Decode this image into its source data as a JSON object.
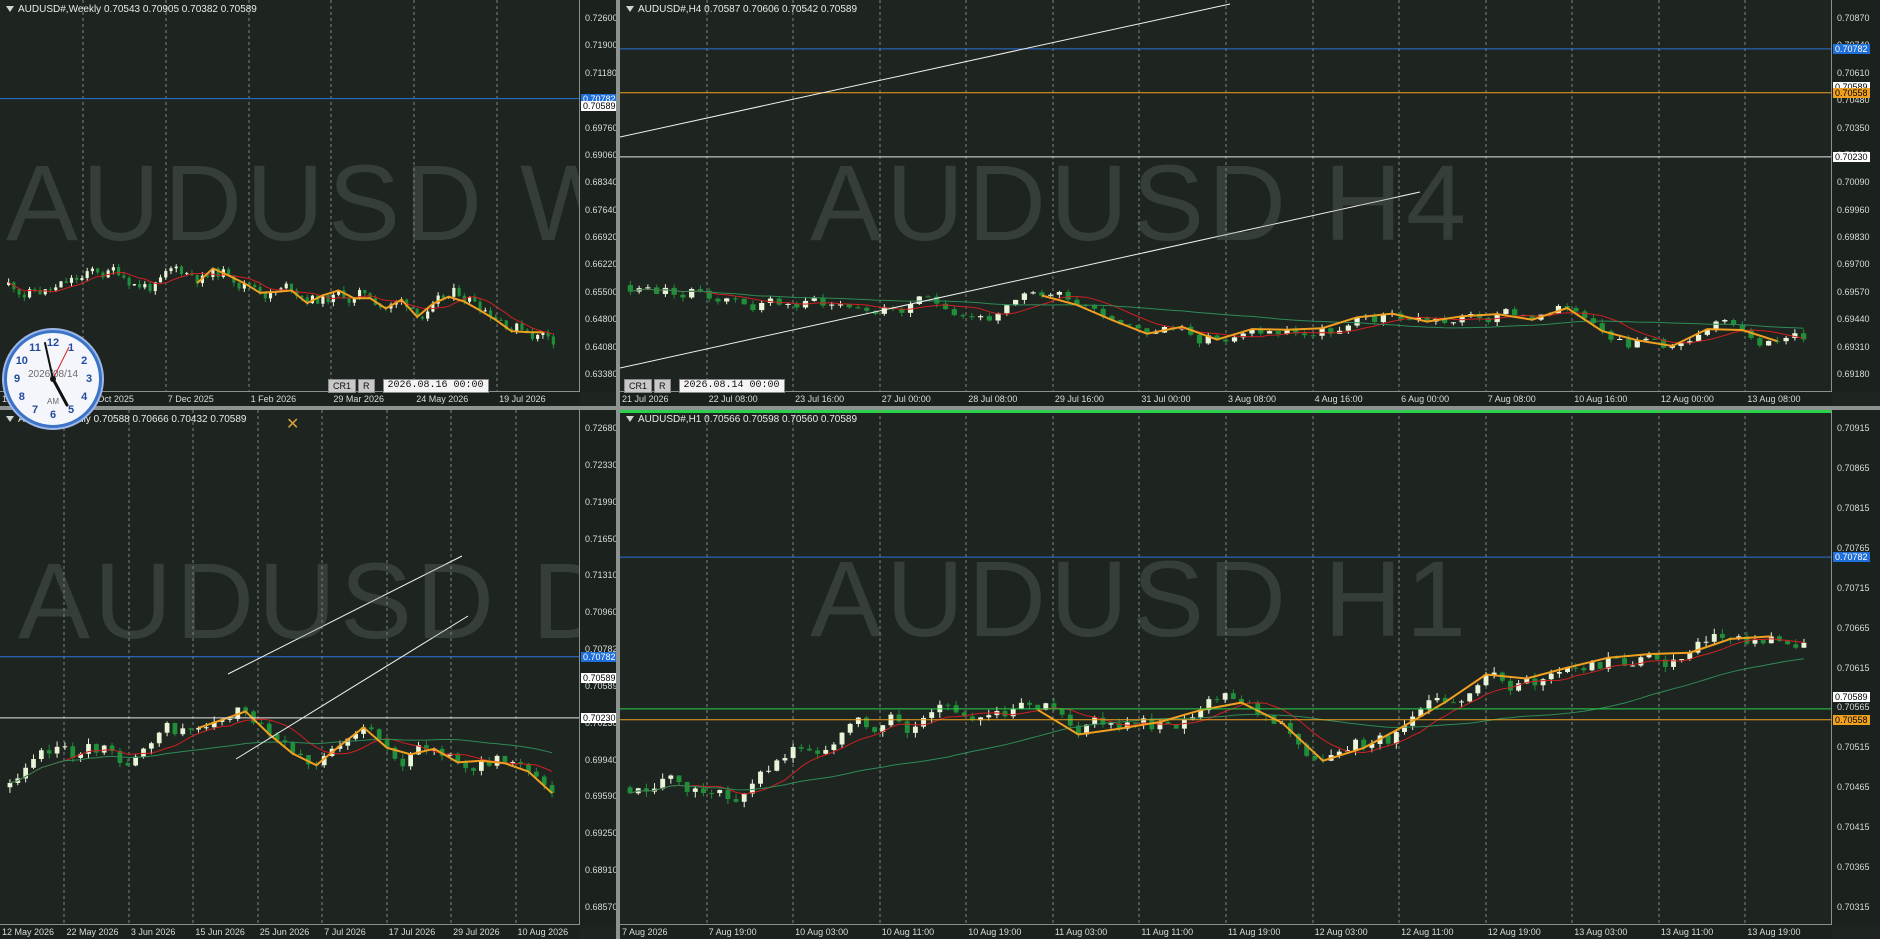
{
  "charts": [
    {
      "id": "w1",
      "header": "AUDUSD#,Weekly  0.70543 0.70905 0.70382 0.70589",
      "watermark": "AUDUSD W1",
      "price_labels": [
        "0.72600",
        "0.71900",
        "0.71180",
        "0.70460",
        "0.69760",
        "0.69060",
        "0.68340",
        "0.67640",
        "0.66920",
        "0.66220",
        "0.65500",
        "0.64800",
        "0.64080",
        "0.63380"
      ],
      "time_labels": [
        "17 Aug 2025",
        "12 Oct 2025",
        "7 Dec 2025",
        "1 Feb 2026",
        "29 Mar 2026",
        "24 May 2026",
        "19 Jul 2026"
      ],
      "tags": [
        {
          "text": "0.70782",
          "bg": "#1e6fd9",
          "fg": "#ffffff",
          "price": 0.70782
        },
        {
          "text": "0.70589",
          "bg": "#ffffff",
          "fg": "#000000",
          "price": 0.70589
        }
      ],
      "status": {
        "b1": "CR1",
        "b2": "R",
        "datetime": "2026.08.16 00:00"
      },
      "ylim": [
        0.6338,
        0.7295
      ],
      "hlines": [
        {
          "price": 0.70782,
          "color": "#2b72d8"
        }
      ],
      "seed": 11,
      "count": 105
    },
    {
      "id": "h4",
      "header": "AUDUSD#,H4  0.70587 0.70606 0.70542 0.70589",
      "watermark": "AUDUSD H4",
      "price_labels": [
        "0.70870",
        "0.70740",
        "0.70610",
        "0.70480",
        "0.70350",
        "0.70230",
        "0.70090",
        "0.69960",
        "0.69830",
        "0.69700",
        "0.69570",
        "0.69440",
        "0.69310",
        "0.69180"
      ],
      "time_labels": [
        "21 Jul 2026",
        "22 Jul 08:00",
        "23 Jul 16:00",
        "27 Jul 00:00",
        "28 Jul 08:00",
        "29 Jul 16:00",
        "31 Jul 00:00",
        "3 Aug 08:00",
        "4 Aug 16:00",
        "6 Aug 00:00",
        "7 Aug 08:00",
        "10 Aug 16:00",
        "12 Aug 00:00",
        "13 Aug 08:00"
      ],
      "tags": [
        {
          "text": "0.70782",
          "bg": "#1e6fd9",
          "fg": "#ffffff",
          "price": 0.70782
        },
        {
          "text": "0.70589",
          "bg": "#ffffff",
          "fg": "#000000",
          "price": 0.70589
        },
        {
          "text": "0.70558",
          "bg": "#f0a020",
          "fg": "#000000",
          "price": 0.70558
        },
        {
          "text": "0.70230",
          "bg": "#ffffff",
          "fg": "#000000",
          "price": 0.7023
        }
      ],
      "status": {
        "b1": "CR1",
        "b2": "R",
        "datetime": "2026.08.14 00:00"
      },
      "ylim": [
        0.6912,
        0.7094
      ],
      "hlines": [
        {
          "price": 0.70782,
          "color": "#2b72d8"
        },
        {
          "price": 0.70558,
          "color": "#f0a020"
        },
        {
          "price": 0.7023,
          "color": "#e8e8e8"
        }
      ],
      "seed": 23,
      "count": 135
    },
    {
      "id": "d1",
      "header": "AUDUSD#,Daily  0.70588 0.70666 0.70432 0.70589",
      "watermark": "AUDUSD D1",
      "price_labels": [
        "0.72680",
        "0.72330",
        "0.71990",
        "0.71650",
        "0.71310",
        "0.70960",
        "0.70782",
        "0.70589",
        "0.70230",
        "0.69940",
        "0.69590",
        "0.69250",
        "0.68910",
        "0.68570"
      ],
      "time_labels": [
        "12 May 2026",
        "22 May 2026",
        "3 Jun 2026",
        "15 Jun 2026",
        "25 Jun 2026",
        "7 Jul 2026",
        "17 Jul 2026",
        "29 Jul 2026",
        "10 Aug 2026"
      ],
      "tags": [
        {
          "text": "0.70782",
          "bg": "#1e6fd9",
          "fg": "#ffffff",
          "price": 0.70782
        },
        {
          "text": "0.70589",
          "bg": "#ffffff",
          "fg": "#000000",
          "price": 0.70589
        },
        {
          "text": "0.70230",
          "bg": "#ffffff",
          "fg": "#000000",
          "price": 0.7023
        }
      ],
      "ylim": [
        0.6852,
        0.7285
      ],
      "hlines": [
        {
          "price": 0.70782,
          "color": "#2b72d8"
        },
        {
          "price": 0.7023,
          "color": "#e8e8e8"
        }
      ],
      "seed": 37,
      "count": 70
    },
    {
      "id": "h1",
      "header": "AUDUSD#,H1  0.70566 0.70598 0.70560 0.70589",
      "watermark": "AUDUSD H1",
      "price_labels": [
        "0.70915",
        "0.70865",
        "0.70815",
        "0.70765",
        "0.70715",
        "0.70665",
        "0.70615",
        "0.70565",
        "0.70515",
        "0.70465",
        "0.70415",
        "0.70365",
        "0.70315"
      ],
      "time_labels": [
        "7 Aug 2026",
        "7 Aug 19:00",
        "10 Aug 03:00",
        "10 Aug 11:00",
        "10 Aug 19:00",
        "11 Aug 03:00",
        "11 Aug 11:00",
        "11 Aug 19:00",
        "12 Aug 03:00",
        "12 Aug 11:00",
        "12 Aug 19:00",
        "13 Aug 03:00",
        "13 Aug 11:00",
        "13 Aug 19:00"
      ],
      "tags": [
        {
          "text": "0.70782",
          "bg": "#1e6fd9",
          "fg": "#ffffff",
          "price": 0.70782
        },
        {
          "text": "0.70589",
          "bg": "#ffffff",
          "fg": "#000000",
          "price": 0.70589
        },
        {
          "text": "0.70558",
          "bg": "#f0a020",
          "fg": "#000000",
          "price": 0.70558
        }
      ],
      "ylim": [
        0.703,
        0.7096
      ],
      "hlines": [
        {
          "price": 0.70782,
          "color": "#2b72d8"
        },
        {
          "price": 0.70558,
          "color": "#f0a020"
        },
        {
          "price": 0.70573,
          "color": "#2ad14a"
        }
      ],
      "seed": 51,
      "count": 145
    }
  ],
  "clock": {
    "date": "2026/08/14",
    "ampm": "AM",
    "numbers": [
      "12",
      "1",
      "2",
      "3",
      "4",
      "5",
      "6",
      "7",
      "8",
      "9",
      "10",
      "11"
    ]
  },
  "colors": {
    "bull": "#e9f5d9",
    "bear": "#1f8f3a",
    "zigzag": "#f0a020",
    "ma_fast": "#d02020",
    "ma_slow": "#2e8b57",
    "grid": "#8a918b"
  }
}
